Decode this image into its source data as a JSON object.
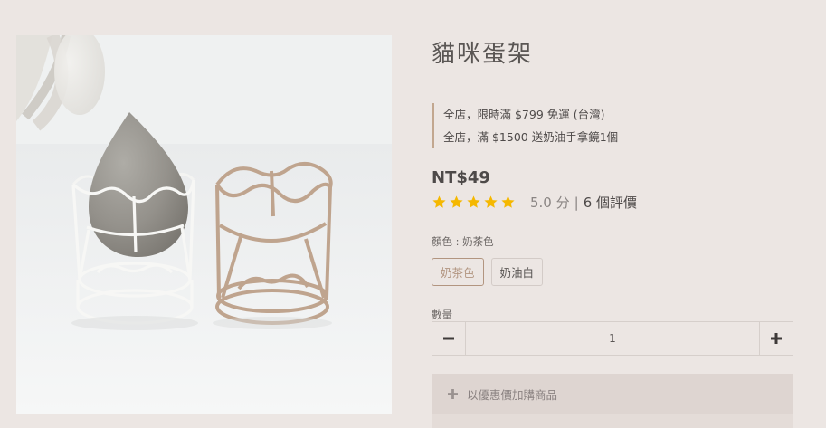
{
  "product": {
    "title": "貓咪蛋架",
    "price": "NT$49",
    "promotions": [
      "全店，限時滿 $799 免運 (台灣)",
      "全店，滿 $1500 送奶油手拿鏡1個"
    ],
    "rating": {
      "stars": 5,
      "score_text": "5.0 分",
      "separator": "|",
      "reviews_text": "6 個評價"
    },
    "color_label": "顏色 : 奶茶色",
    "variants": [
      {
        "label": "奶茶色",
        "selected": true
      },
      {
        "label": "奶油白",
        "selected": false
      }
    ],
    "quantity_label": "數量",
    "quantity": "1",
    "addon_label": "以優惠價加購商品"
  },
  "icons": {
    "star": "star-icon",
    "minus": "minus-icon",
    "plus": "plus-icon"
  },
  "colors": {
    "background": "#ece6e3",
    "accent": "#b29580",
    "star": "#f5b800",
    "promo_border": "#c2a78f",
    "addon_bg": "#ded5d1"
  }
}
